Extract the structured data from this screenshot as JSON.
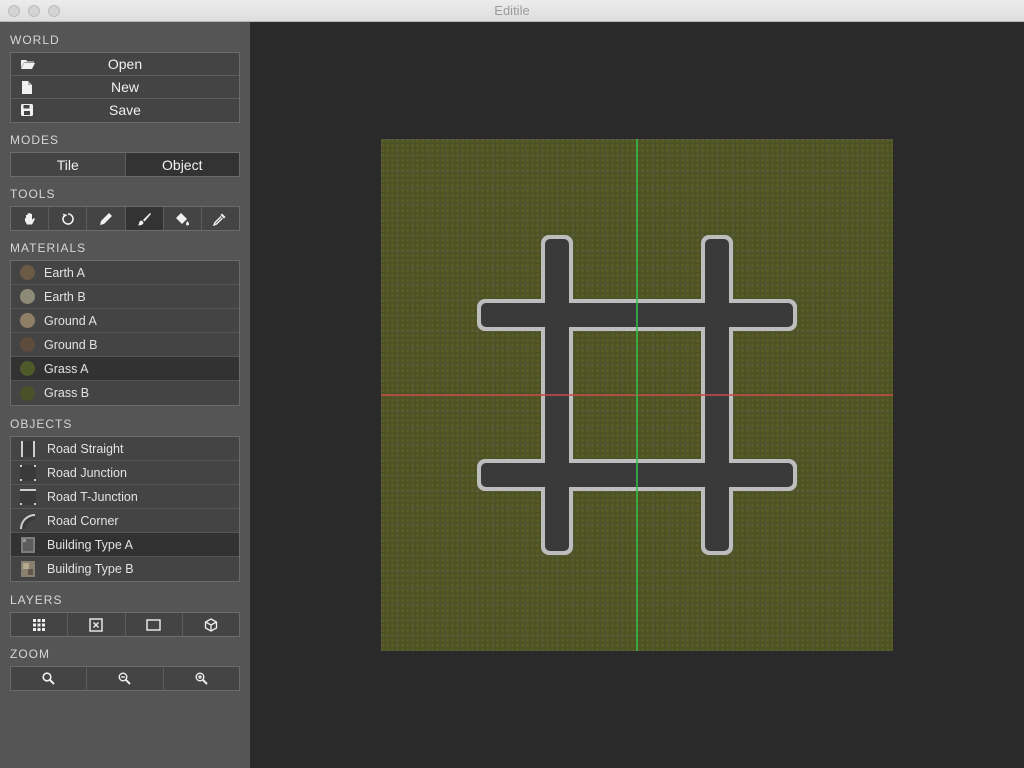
{
  "window": {
    "title": "Editile"
  },
  "sidebar": {
    "world": {
      "title": "WORLD",
      "buttons": [
        {
          "label": "Open",
          "icon": "folder-icon"
        },
        {
          "label": "New",
          "icon": "file-icon"
        },
        {
          "label": "Save",
          "icon": "floppy-disk-icon"
        }
      ]
    },
    "modes": {
      "title": "MODES",
      "options": [
        {
          "label": "Tile"
        },
        {
          "label": "Object",
          "active": true
        }
      ]
    },
    "tools": {
      "title": "TOOLS",
      "icons": [
        "hand-icon",
        "rotate-icon",
        "pencil-icon",
        "brush-icon",
        "paint-bucket-icon",
        "eyedropper-icon"
      ],
      "active": "brush-icon"
    },
    "materials": {
      "title": "MATERIALS",
      "items": [
        {
          "label": "Earth A",
          "color": "#6b5a45"
        },
        {
          "label": "Earth B",
          "color": "#8e8a78"
        },
        {
          "label": "Ground A",
          "color": "#8f7f66"
        },
        {
          "label": "Ground B",
          "color": "#5d4c3c"
        },
        {
          "label": "Grass A",
          "color": "#4e5a2a",
          "selected": true
        },
        {
          "label": "Grass B",
          "color": "#4a5128"
        }
      ]
    },
    "objects": {
      "title": "OBJECTS",
      "items": [
        {
          "label": "Road Straight",
          "icon": "road-straight-icon"
        },
        {
          "label": "Road Junction",
          "icon": "road-junction-icon"
        },
        {
          "label": "Road T-Junction",
          "icon": "road-t-junction-icon"
        },
        {
          "label": "Road Corner",
          "icon": "road-corner-icon"
        },
        {
          "label": "Building Type A",
          "icon": "building-a-icon",
          "selected": true
        },
        {
          "label": "Building Type B",
          "icon": "building-b-icon"
        }
      ]
    },
    "layers": {
      "title": "LAYERS",
      "icons": [
        "grid-layer-icon",
        "object-layer-icon",
        "bounds-layer-icon",
        "3d-layer-icon"
      ]
    },
    "zoom": {
      "title": "ZOOM",
      "icons": [
        "zoom-reset-icon",
        "zoom-out-icon",
        "zoom-in-icon"
      ]
    }
  },
  "canvas": {
    "colors": {
      "grass": "#4d5325",
      "road": "#3a3a3a",
      "road_edge": "#bdbdbd",
      "x_axis": "#c84a4a",
      "y_axis": "#33c24a"
    }
  }
}
